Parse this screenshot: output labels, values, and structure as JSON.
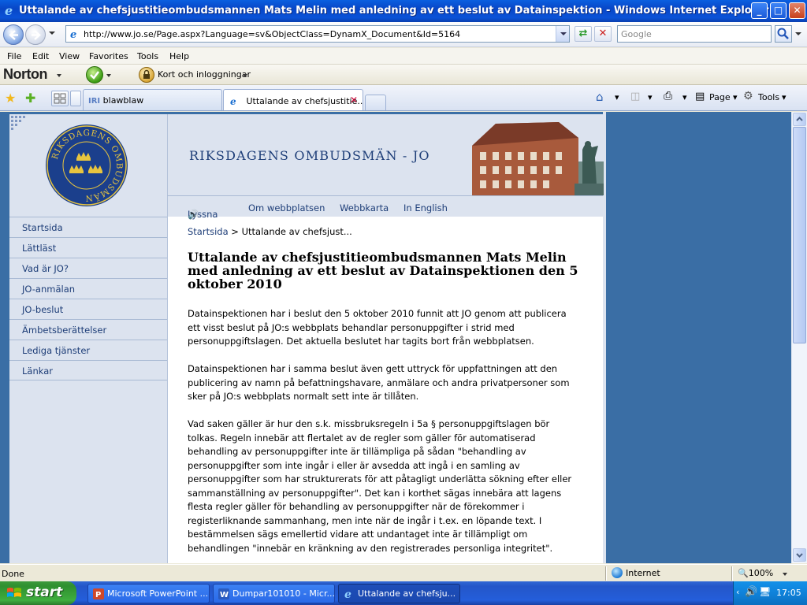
{
  "window": {
    "title": "Uttalande av chefsjustitieombudsmannen Mats Melin med anledning av ett beslut av Datainspektion - Windows Internet Explorer",
    "minimize": "_",
    "maximize": "□",
    "close": "✕"
  },
  "address_bar": {
    "url": "http://www.jo.se/Page.aspx?Language=sv&ObjectClass=DynamX_Document&Id=5164",
    "search_placeholder": "Google"
  },
  "menu": [
    "File",
    "Edit",
    "View",
    "Favorites",
    "Tools",
    "Help"
  ],
  "norton_bar": {
    "brand": "Norton",
    "login_label": "Kort och inloggningar"
  },
  "tabs": [
    {
      "label": "blawblaw",
      "prefix": "IRI",
      "active": false
    },
    {
      "label": "Uttalande av chefsjustitie...",
      "active": true
    }
  ],
  "toolbar_right": {
    "page_label": "Page",
    "tools_label": "Tools"
  },
  "site": {
    "header_title": "RIKSDAGENS OMBUDSMÄN - JO",
    "seal_text": "RIKSDAGENS OMBUDSMÄN",
    "top_nav": [
      "Lyssna",
      "Om webbplatsen",
      "Webbkarta",
      "In English"
    ],
    "side_nav": [
      "Startsida",
      "Lättläst",
      "Vad är JO?",
      "JO-anmälan",
      "JO-beslut",
      "Ämbetsberättelser",
      "Lediga tjänster",
      "Länkar"
    ],
    "breadcrumb": {
      "home": "Startsida",
      "separator": ">",
      "current": "Uttalande av chefsjust..."
    },
    "headline": "Uttalande av chefsjustitieombudsmannen Mats Melin med anledning av ett beslut av Datainspektionen den 5 oktober 2010",
    "paragraphs": [
      "Datainspektionen har i beslut den 5 oktober 2010 funnit att JO genom att publicera ett visst beslut på JO:s webbplats behandlar personuppgifter i strid med personuppgiftslagen. Det aktuella beslutet har tagits bort från webbplatsen.",
      "Datainspektionen har i samma beslut även gett uttryck för uppfattningen att den publicering av namn på befattningshavare, anmälare och andra privatpersoner som sker på JO:s webbplats normalt sett inte är tillåten.",
      "Vad saken gäller är hur den s.k. missbruksregeln i 5a § personuppgiftslagen bör tolkas. Regeln innebär att flertalet av de regler som gäller för automatiserad behandling av personuppgifter inte är tillämpliga på sådan \"behandling av personuppgifter som inte ingår i eller är avsedda att ingå i en samling av personuppgifter som har strukturerats för att påtagligt underlätta sökning efter eller sammanställning av personuppgifter\". Det kan i korthet sägas innebära att lagens flesta regler gäller för behandling av personuppgifter när de förekommer i registerliknande sammanhang, men inte när de ingår i t.ex. en löpande text. I bestämmelsen sägs emellertid vidare att undantaget inte är tillämpligt om behandlingen \"innebär en kränkning av den registrerades personliga integritet\"."
    ]
  },
  "status_bar": {
    "status": "Done",
    "zone": "Internet",
    "zoom": "100%"
  },
  "taskbar": {
    "start": "start",
    "tasks": [
      {
        "label": "Microsoft PowerPoint ...",
        "active": false
      },
      {
        "label": "Dumpar101010 - Micr...",
        "active": false
      },
      {
        "label": "Uttalande av chefsju...",
        "active": true
      }
    ],
    "clock": "17:05"
  }
}
